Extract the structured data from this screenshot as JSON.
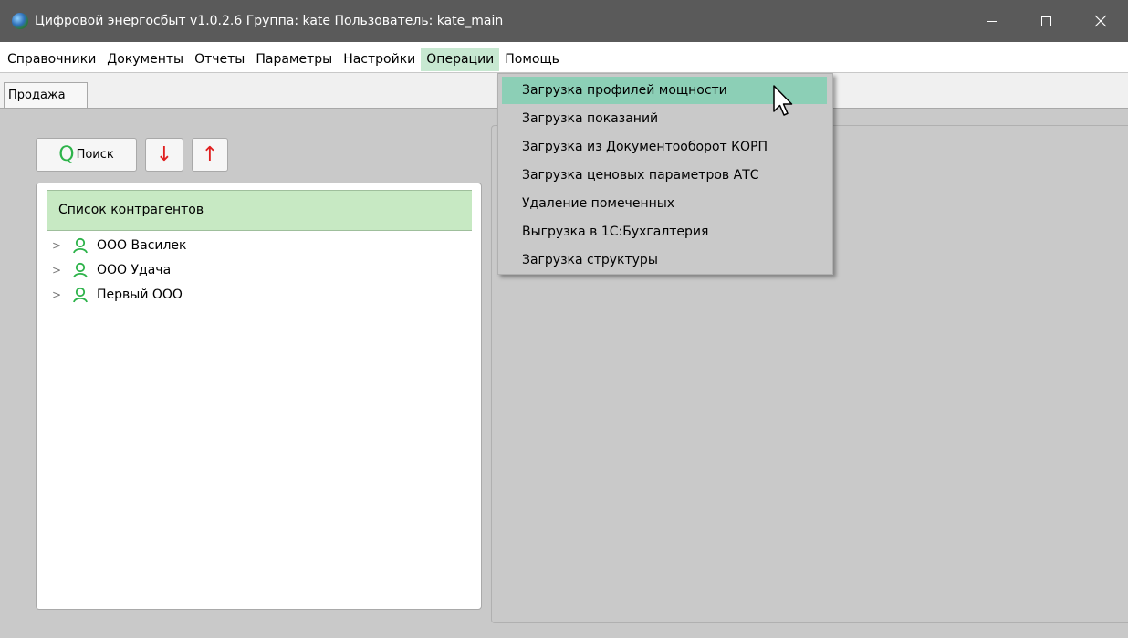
{
  "window": {
    "title": "Цифровой энергосбыт v1.0.2.6 Группа: kate Пользователь: kate_main",
    "icon": "globe-icon",
    "controls": [
      "minimize-icon",
      "maximize-icon",
      "close-icon"
    ]
  },
  "menubar": {
    "items": [
      {
        "label": "Справочники"
      },
      {
        "label": "Документы"
      },
      {
        "label": "Отчеты"
      },
      {
        "label": "Параметры"
      },
      {
        "label": "Настройки"
      },
      {
        "label": "Операции",
        "active": true
      },
      {
        "label": "Помощь"
      }
    ]
  },
  "tabs": [
    {
      "label": "Продажа",
      "selected": true
    }
  ],
  "toolbar": {
    "search_label": "Поиск",
    "search_icon": "search-icon",
    "down_icon": "arrow-down-icon",
    "up_icon": "arrow-up-icon"
  },
  "contractors": {
    "header": "Список контрагентов",
    "items": [
      {
        "label": "ООО Василек"
      },
      {
        "label": "ООО Удача"
      },
      {
        "label": "Первый ООО"
      }
    ],
    "item_icon": "person-icon"
  },
  "operations_menu": {
    "items": [
      {
        "label": "Загрузка профилей мощности",
        "highlighted": true
      },
      {
        "label": "Загрузка показаний"
      },
      {
        "label": "Загрузка из Документооборот КОРП"
      },
      {
        "label": "Загрузка ценовых параметров АТС"
      },
      {
        "label": "Удаление помеченных"
      },
      {
        "label": "Выгрузка в 1С:Бухгалтерия"
      },
      {
        "label": "Загрузка структуры"
      }
    ]
  },
  "colors": {
    "titlebar": "#5a5a5a",
    "menu_active": "#c7e8d1",
    "list_header": "#c7e9c3",
    "dropdown_highlight": "#8ccfb6",
    "person_icon": "#2db34a",
    "arrow": "#e02020"
  }
}
